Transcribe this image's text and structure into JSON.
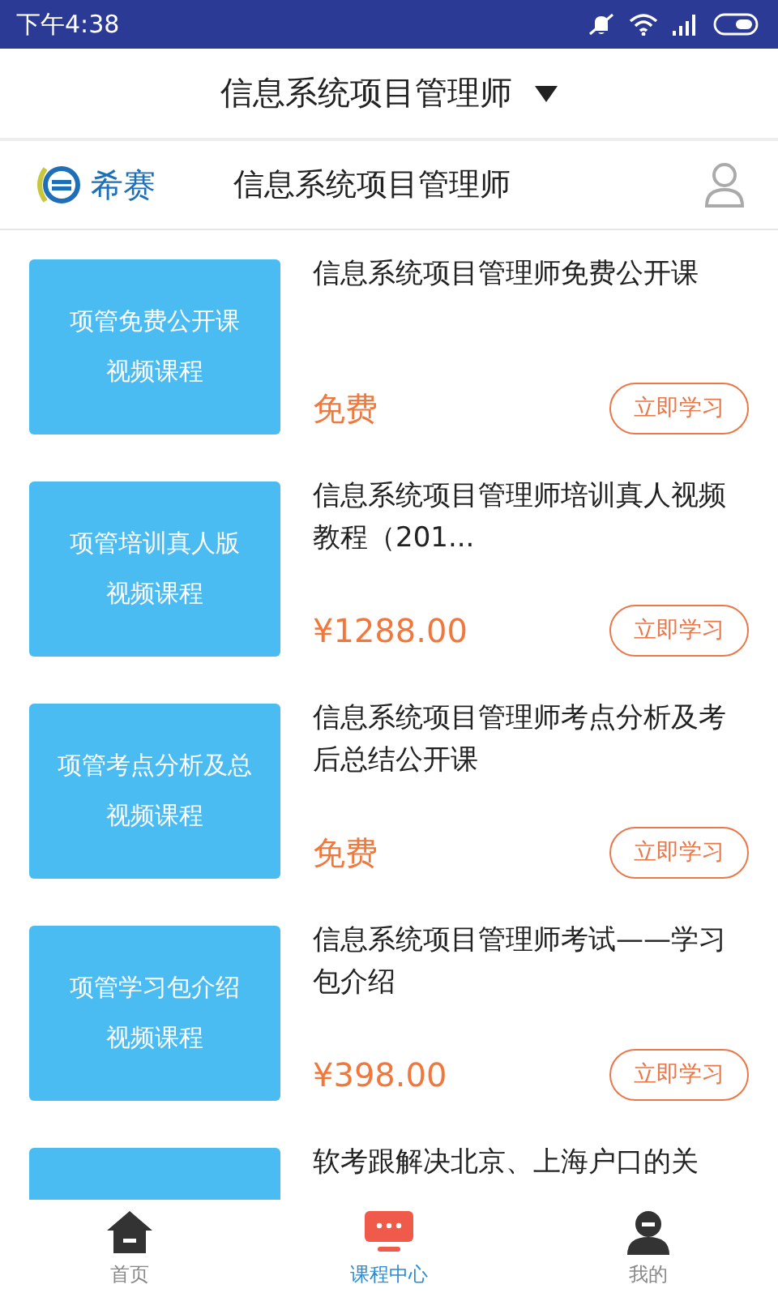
{
  "status_bar": {
    "time": "下午4:38"
  },
  "header": {
    "title": "信息系统项目管理师"
  },
  "brand_bar": {
    "logo_text": "希赛",
    "title": "信息系统项目管理师"
  },
  "courses": [
    {
      "thumb_title": "项管免费公开课",
      "thumb_subtitle": "视频课程",
      "title": "信息系统项目管理师免费公开课",
      "price": "免费",
      "button": "立即学习"
    },
    {
      "thumb_title": "项管培训真人版",
      "thumb_subtitle": "视频课程",
      "title": "信息系统项目管理师培训真人视频教程（201...",
      "price": "¥1288.00",
      "button": "立即学习"
    },
    {
      "thumb_title": "项管考点分析及总",
      "thumb_subtitle": "视频课程",
      "title": "信息系统项目管理师考点分析及考后总结公开课",
      "price": "免费",
      "button": "立即学习"
    },
    {
      "thumb_title": "项管学习包介绍",
      "thumb_subtitle": "视频课程",
      "title": "信息系统项目管理师考试——学习包介绍",
      "price": "¥398.00",
      "button": "立即学习"
    },
    {
      "title": "软考跟解决北京、上海户口的关"
    }
  ],
  "nav": [
    {
      "kind": "home",
      "label": "首页",
      "selected": false
    },
    {
      "kind": "courses",
      "label": "课程中心",
      "selected": true
    },
    {
      "kind": "me",
      "label": "我的",
      "selected": false
    }
  ]
}
